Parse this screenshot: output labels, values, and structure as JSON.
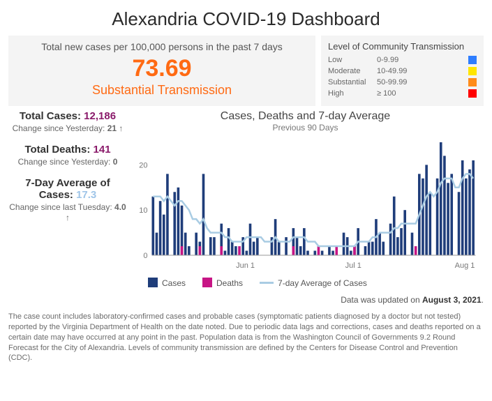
{
  "title": "Alexandria COVID-19 Dashboard",
  "rate_card": {
    "subtitle": "Total new cases per 100,000 persons in the past 7 days",
    "value": "73.69",
    "label": "Substantial Transmission"
  },
  "transmission_legend": {
    "title": "Level of Community Transmission",
    "rows": [
      {
        "level": "Low",
        "range": "0-9.99",
        "swatch_class": "sw-blue"
      },
      {
        "level": "Moderate",
        "range": "10-49.99",
        "swatch_class": "sw-yellow"
      },
      {
        "level": "Substantial",
        "range": "50-99.99",
        "swatch_class": "sw-orange"
      },
      {
        "level": "High",
        "range": "≥ 100",
        "swatch_class": "sw-red"
      }
    ]
  },
  "stats": {
    "total_cases": {
      "label": "Total Cases: ",
      "value": "12,186",
      "change_label": "Change since Yesterday:",
      "change_value": "21 ↑"
    },
    "total_deaths": {
      "label": "Total Deaths: ",
      "value": "141",
      "change_label": "Change since Yesterday:",
      "change_value": "0"
    },
    "avg7": {
      "label": "7-Day Average of Cases: ",
      "value": "17.3",
      "change_label": "Change since last Tuesday:",
      "change_value": "4.0  ↑"
    }
  },
  "chart": {
    "title": "Cases, Deaths and 7-day Average",
    "subtitle": "Previous 90 Days",
    "legend": {
      "cases": "Cases",
      "deaths": "Deaths",
      "avg": "7-day Average of Cases"
    },
    "updated_prefix": "Data was updated on ",
    "updated_date": "August 3, 2021"
  },
  "footnote": "The case count includes laboratory-confirmed cases and probable cases (symptomatic patients diagnosed by a doctor but not tested) reported by the Virginia Department of Health on the date noted. Due to periodic data lags and corrections, cases and deaths reported on a certain date may have occurred at any point in the past. Population data is from the Washington Council of Governments 9.2 Round Forecast for the City of Alexandria. Levels of community transmission are defined by the Centers for Disease Control and Prevention (CDC).",
  "chart_data": {
    "type": "bar+line",
    "title": "Cases, Deaths and 7-day Average",
    "subtitle": "Previous 90 Days",
    "ylabel": "",
    "ylim": [
      0,
      25
    ],
    "y_ticks": [
      0,
      10,
      20
    ],
    "x_tick_labels": [
      "Jun 1",
      "Jul 1",
      "Aug 1"
    ],
    "series": [
      {
        "name": "Cases",
        "type": "bar",
        "color": "#1f3d7a",
        "values": [
          13,
          5,
          12,
          9,
          18,
          0,
          14,
          15,
          11,
          5,
          2,
          0,
          5,
          3,
          18,
          0,
          4,
          4,
          0,
          7,
          1,
          6,
          3,
          2,
          0,
          4,
          1,
          7,
          3,
          4,
          0,
          0,
          0,
          4,
          8,
          3,
          0,
          4,
          0,
          6,
          4,
          2,
          6,
          1,
          0,
          1,
          0,
          1,
          0,
          2,
          1,
          0,
          0,
          5,
          4,
          1,
          2,
          6,
          0,
          2,
          3,
          3,
          8,
          5,
          3,
          0,
          7,
          13,
          4,
          6,
          10,
          0,
          5,
          0,
          18,
          17,
          20,
          14,
          0,
          17,
          25,
          22,
          16,
          18,
          0,
          14,
          21,
          17,
          19,
          21
        ]
      },
      {
        "name": "Deaths",
        "type": "bar",
        "color": "#c71585",
        "values": [
          0,
          0,
          0,
          0,
          0,
          0,
          0,
          0,
          2,
          0,
          0,
          0,
          0,
          2,
          0,
          0,
          0,
          0,
          0,
          2,
          0,
          0,
          0,
          0,
          2,
          0,
          0,
          0,
          0,
          0,
          0,
          0,
          0,
          0,
          0,
          0,
          0,
          0,
          0,
          2,
          0,
          0,
          0,
          0,
          0,
          0,
          2,
          0,
          0,
          0,
          0,
          2,
          0,
          0,
          0,
          0,
          2,
          0,
          0,
          0,
          0,
          0,
          0,
          0,
          0,
          0,
          0,
          0,
          0,
          0,
          0,
          0,
          0,
          2,
          0,
          0,
          0,
          0,
          0,
          0,
          0,
          0,
          0,
          0,
          0,
          0,
          0,
          0,
          0,
          0
        ]
      },
      {
        "name": "7-day Average of Cases",
        "type": "line",
        "color": "#a9cce3",
        "values": [
          13,
          13,
          13,
          12,
          13,
          12,
          11,
          12,
          12,
          11,
          10,
          8,
          8,
          7,
          8,
          6,
          5,
          5,
          5,
          5,
          4,
          4,
          3,
          3,
          3,
          3,
          4,
          4,
          4,
          4,
          4,
          3,
          3,
          3,
          4,
          3,
          3,
          3,
          3,
          4,
          4,
          4,
          4,
          3,
          3,
          3,
          2,
          2,
          2,
          2,
          2,
          2,
          2,
          2,
          2,
          2,
          2,
          3,
          3,
          3,
          3,
          4,
          4,
          5,
          5,
          5,
          5,
          6,
          6,
          7,
          7,
          7,
          7,
          7,
          9,
          11,
          13,
          14,
          13,
          14,
          16,
          17,
          17,
          17,
          15,
          15,
          17,
          18,
          18,
          17
        ]
      }
    ]
  }
}
